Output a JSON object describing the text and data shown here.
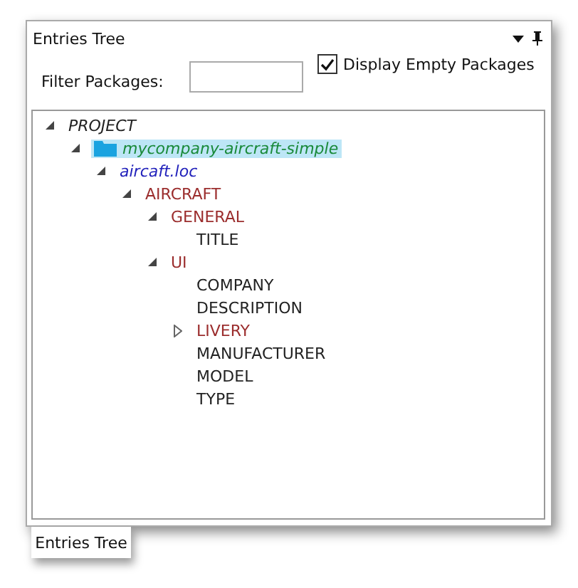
{
  "panel": {
    "title": "Entries Tree"
  },
  "filter": {
    "label": "Filter Packages:"
  },
  "display_empty": {
    "label": "Display Empty Packages",
    "checked": true
  },
  "tree": [
    {
      "label": "PROJECT",
      "kind": "project",
      "expanded": true,
      "selected": false,
      "children": [
        {
          "label": "mycompany-aircraft-simple",
          "kind": "package",
          "expanded": true,
          "selected": true,
          "children": [
            {
              "label": "aircaft.loc",
              "kind": "file",
              "expanded": true,
              "selected": false,
              "children": [
                {
                  "label": "AIRCRAFT",
                  "kind": "group",
                  "expanded": true,
                  "selected": false,
                  "children": [
                    {
                      "label": "GENERAL",
                      "kind": "group",
                      "expanded": true,
                      "selected": false,
                      "children": [
                        {
                          "label": "TITLE",
                          "kind": "entry",
                          "selected": false
                        }
                      ]
                    },
                    {
                      "label": "UI",
                      "kind": "group",
                      "expanded": true,
                      "selected": false,
                      "children": [
                        {
                          "label": "COMPANY",
                          "kind": "entry",
                          "selected": false
                        },
                        {
                          "label": "DESCRIPTION",
                          "kind": "entry",
                          "selected": false
                        },
                        {
                          "label": "LIVERY",
                          "kind": "group",
                          "expanded": false,
                          "selected": false
                        },
                        {
                          "label": "MANUFACTURER",
                          "kind": "entry",
                          "selected": false
                        },
                        {
                          "label": "MODEL",
                          "kind": "entry",
                          "selected": false
                        },
                        {
                          "label": "TYPE",
                          "kind": "entry",
                          "selected": false
                        }
                      ]
                    }
                  ]
                }
              ]
            }
          ]
        }
      ]
    }
  ],
  "bottom_tabs": [
    {
      "label": "Entries Tree",
      "selected": true
    }
  ]
}
